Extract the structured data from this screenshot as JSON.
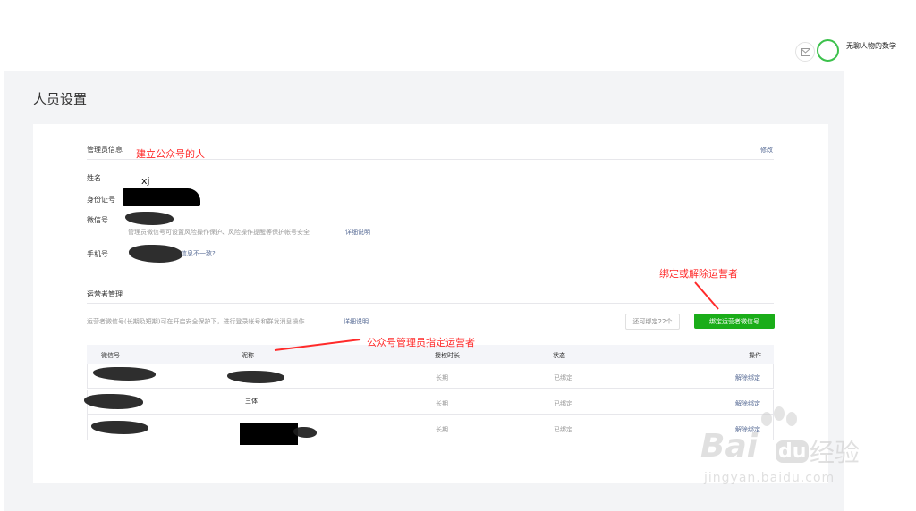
{
  "header": {
    "account_name": "无聊人物的数学"
  },
  "page": {
    "title": "人员设置"
  },
  "admin": {
    "section_title": "管理员信息",
    "edit_link": "修改",
    "fields": [
      {
        "label": "姓名",
        "value": "xj"
      },
      {
        "label": "身份证号",
        "value": ""
      },
      {
        "label": "微信号",
        "value": ""
      },
      {
        "label": "手机号",
        "value": ""
      }
    ],
    "wechat_hint": "管理员微信号可设置风险操作保护、风险操作提醒等保护帐号安全",
    "wechat_hint_link": "详细说明",
    "phone_mismatch_link": "信息不一致?"
  },
  "operators": {
    "section_title": "运营者管理",
    "hint": "运营者微信号(长期及短期)可在开启安全保护下，进行登录帐号和群发消息操作",
    "hint_link": "详细说明",
    "quota": "还可绑定22个",
    "bind_button": "绑定运营者微信号",
    "columns": [
      "微信号",
      "昵称",
      "授权时长",
      "状态",
      "操作"
    ],
    "rows": [
      {
        "wechat_id": "",
        "nickname": "",
        "duration": "长期",
        "status": "已绑定",
        "action": "解除绑定"
      },
      {
        "wechat_id": "",
        "nickname": "三体",
        "duration": "长期",
        "status": "已绑定",
        "action": "解除绑定"
      },
      {
        "wechat_id": "",
        "nickname": "",
        "duration": "长期",
        "status": "已绑定",
        "action": "解除绑定"
      }
    ]
  },
  "annotations": {
    "creator": "建立公众号的人",
    "bind_unbind": "绑定或解除运营者",
    "admin_assign": "公众号管理员指定运营者"
  },
  "watermark": {
    "brand": "Bai",
    "brand2": "经验",
    "url": "jingyan.baidu.com"
  },
  "colors": {
    "primary_green": "#1aad19",
    "link_blue": "#576b95",
    "annotation_red": "#ff2a2a"
  }
}
